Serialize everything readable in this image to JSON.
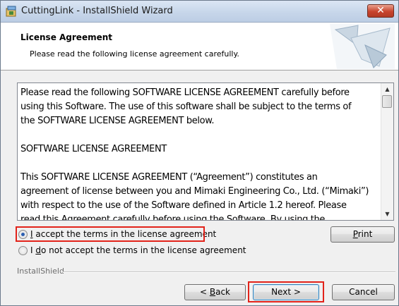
{
  "window": {
    "title": "CuttingLink - InstallShield Wizard"
  },
  "header": {
    "title": "License Agreement",
    "subtitle": "Please read the following license agreement carefully."
  },
  "license": {
    "paragraphs": [
      [
        "Please read the following SOFTWARE LICENSE AGREEMENT carefully before",
        "using this Software.  The use of this software shall be subject to the terms of",
        "the SOFTWARE LICENSE AGREEMENT below."
      ],
      [
        "SOFTWARE LICENSE AGREEMENT"
      ],
      [
        "This SOFTWARE LICENSE AGREEMENT (“Agreement”) constitutes an",
        "agreement of license between you and Mimaki Engineering Co., Ltd. (“Mimaki”)",
        "with respect to the use of the Software defined in Article 1.2 hereof. Please",
        "read this Agreement carefully before using the Software.  By using the"
      ]
    ]
  },
  "options": {
    "accept": {
      "u": "I",
      "rest": " accept the terms in the license agreement",
      "selected": true
    },
    "decline": {
      "pre": "I ",
      "u": "d",
      "rest": "o not accept the terms in the license agreement",
      "selected": false
    }
  },
  "buttons": {
    "print": {
      "u": "P",
      "rest": "rint"
    },
    "back": {
      "pre": "< ",
      "u": "B",
      "rest": "ack"
    },
    "next": "Next >",
    "cancel": "Cancel"
  },
  "group_label": "InstallShield",
  "colors": {
    "highlight": "#e2231a",
    "title_gradient_top": "#dbe6f4",
    "close_button": "#c8432d"
  }
}
